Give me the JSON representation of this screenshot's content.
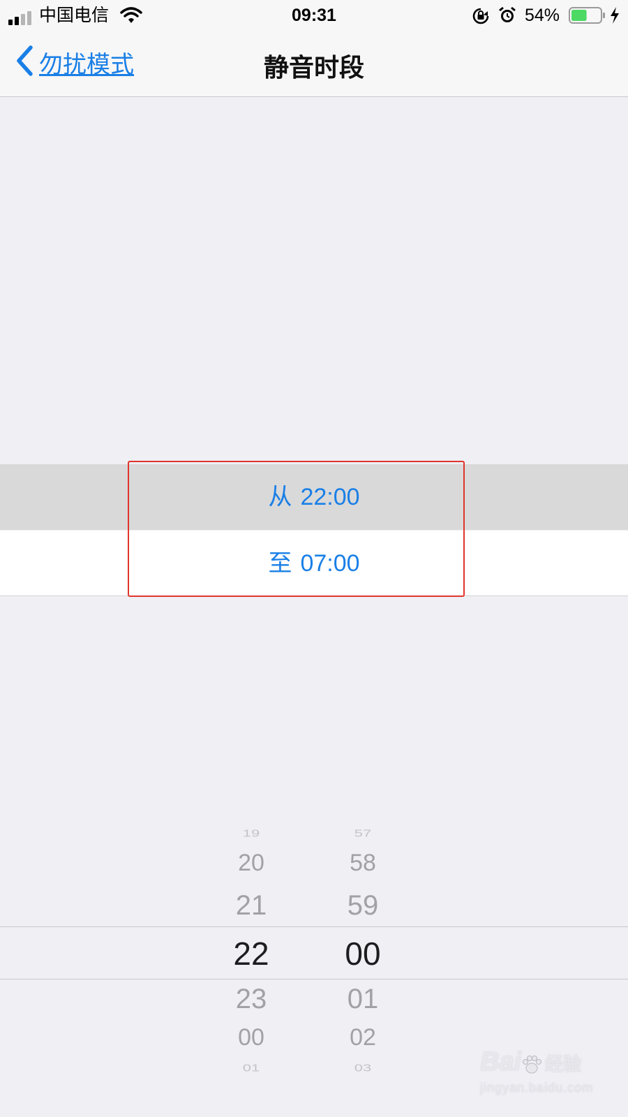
{
  "status_bar": {
    "carrier": "中国电信",
    "time": "09:31",
    "battery_percent": "54%",
    "battery_level": 0.54,
    "icons": [
      "signal-icon",
      "wifi-icon",
      "rotation-lock-icon",
      "alarm-icon",
      "battery-icon",
      "charging-icon"
    ]
  },
  "nav": {
    "back_label": "勿扰模式",
    "title": "静音时段"
  },
  "schedule": {
    "from_prefix": "从",
    "from_time": "22:00",
    "to_prefix": "至",
    "to_time": "07:00"
  },
  "picker": {
    "hours": [
      "19",
      "20",
      "21",
      "22",
      "23",
      "00",
      "01"
    ],
    "minutes": [
      "57",
      "58",
      "59",
      "00",
      "01",
      "02",
      "03"
    ],
    "selected_hour": "22",
    "selected_minute": "00"
  },
  "watermark": {
    "brand": "Bai",
    "brand_suffix": "经验",
    "url": "jingyan.baidu.com"
  },
  "colors": {
    "accent": "#1a7fe6",
    "highlight_box": "#e0352b",
    "background": "#efeff4"
  }
}
